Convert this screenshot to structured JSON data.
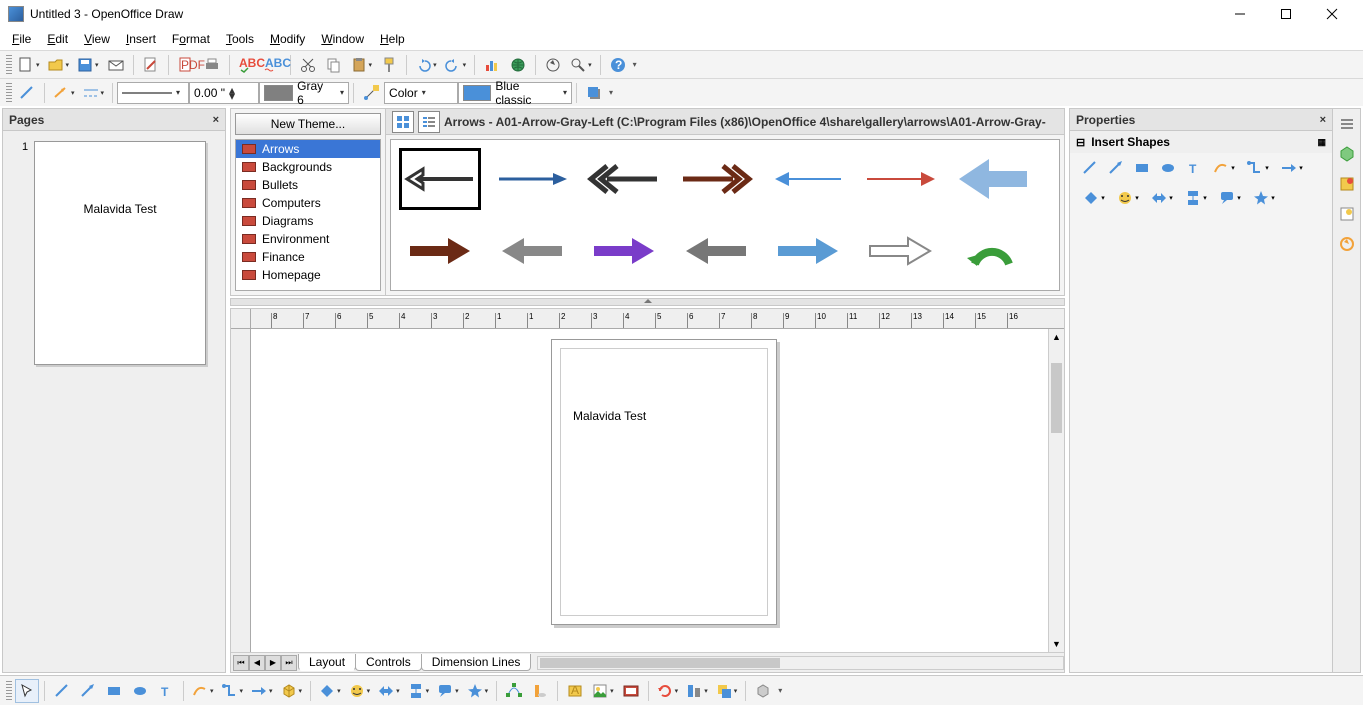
{
  "window": {
    "title": "Untitled 3 - OpenOffice Draw"
  },
  "menu": {
    "file": "File",
    "edit": "Edit",
    "view": "View",
    "insert": "Insert",
    "format": "Format",
    "tools": "Tools",
    "modify": "Modify",
    "window": "Window",
    "help": "Help"
  },
  "toolbar2": {
    "line_width": "0.00 \"",
    "color_name": "Gray 6",
    "fill_mode": "Color",
    "fill_name": "Blue classic"
  },
  "pages_panel": {
    "title": "Pages",
    "thumb_text": "Malavida Test",
    "page_number": "1"
  },
  "gallery": {
    "new_theme": "New Theme...",
    "path": "Arrows - A01-Arrow-Gray-Left (C:\\Program Files (x86)\\OpenOffice 4\\share\\gallery\\arrows\\A01-Arrow-Gray-",
    "themes": [
      "Arrows",
      "Backgrounds",
      "Bullets",
      "Computers",
      "Diagrams",
      "Environment",
      "Finance",
      "Homepage"
    ],
    "selected_theme": "Arrows"
  },
  "canvas_text": "Malavida Test",
  "layer_tabs": {
    "layout": "Layout",
    "controls": "Controls",
    "dimension": "Dimension Lines"
  },
  "properties": {
    "title": "Properties",
    "insert_shapes": "Insert Shapes"
  },
  "ruler_labels": [
    "8",
    "7",
    "6",
    "5",
    "4",
    "3",
    "2",
    "1",
    "1",
    "2",
    "3",
    "4",
    "5",
    "6",
    "7",
    "8",
    "9",
    "10",
    "11",
    "12",
    "13",
    "14",
    "15",
    "16"
  ],
  "colors": {
    "gray6": "#808080",
    "blue_classic": "#4a90d9"
  }
}
